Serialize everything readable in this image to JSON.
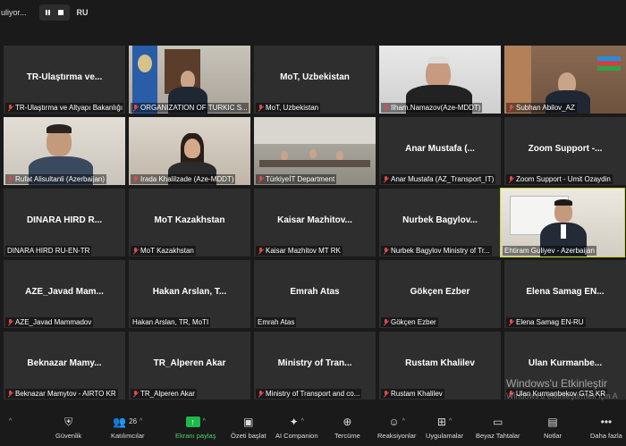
{
  "topbar": {
    "status": "uliyor...",
    "lang": "RU"
  },
  "tiles": [
    {
      "big": "TR-Ulaştırma ve...",
      "name": "TR-Ulaştırma ve Altyapı Bakanlığı"
    },
    {
      "big": "",
      "name": "ORGANIZATION OF TURKIC S..."
    },
    {
      "big": "MoT, Uzbekistan",
      "name": "MoT, Uzbekistan"
    },
    {
      "big": "",
      "name": "Ilham.Namazov(Aze-MDDT)"
    },
    {
      "big": "",
      "name": "Subhan Abilov_AZ"
    },
    {
      "big": "",
      "name": "Rufat Alisultanli (Azerbaijan)"
    },
    {
      "big": "",
      "name": "Irada Khalilzade (Aze-MDDT)"
    },
    {
      "big": "",
      "name": "TürkiyeİT Department"
    },
    {
      "big": "Anar Mustafa (...",
      "name": "Anar Mustafa (AZ_Transport_IT)"
    },
    {
      "big": "Zoom Support -...",
      "name": "Zoom Support - Umit Ozaydin"
    },
    {
      "big": "DINARA HIRD R...",
      "name": "DINARA HIRD RU-EN-TR"
    },
    {
      "big": "MoT Kazakhstan",
      "name": "MoT Kazakhstan"
    },
    {
      "big": "Kaisar Mazhitov...",
      "name": "Kaisar Mazhitov MT RK"
    },
    {
      "big": "Nurbek Bagylov...",
      "name": "Nurbek Bagylov Ministry of Tr..."
    },
    {
      "big": "",
      "name": "Ehtiram Guliyev - Azerbaijan"
    },
    {
      "big": "AZE_Javad Mam...",
      "name": "AZE_Javad Mammadov"
    },
    {
      "big": "Hakan Arslan, T...",
      "name": "Hakan Arslan, TR, MoTI"
    },
    {
      "big": "Emrah Atas",
      "name": "Emrah Atas"
    },
    {
      "big": "Gökçen Ezber",
      "name": "Gökçen Ezber"
    },
    {
      "big": "Elena Samag EN...",
      "name": "Elena Samag EN-RU"
    },
    {
      "big": "Beknazar Mamy...",
      "name": "Beknazar Mamytov - AIRTO KR"
    },
    {
      "big": "TR_Alperen Akar",
      "name": "TR_Alperen Akar"
    },
    {
      "big": "Ministry of Tran...",
      "name": "Ministry of Transport and co..."
    },
    {
      "big": "Rustam Khalilev",
      "name": "Rustam Khalilev"
    },
    {
      "big": "Ulan Kurmanbe...",
      "name": "Ulan Kurmanbekov GTS KR"
    }
  ],
  "watermark": {
    "line1": "Windows'u Etkinleştir",
    "line2": "Windows'u etkinleştirmek için A"
  },
  "toolbar": {
    "security": "Güvenlik",
    "participants": "Katılımcılar",
    "participants_count": "26",
    "share": "Ekranı paylaş",
    "summary": "Özeti başlat",
    "ai": "AI Companion",
    "translate": "Tercüme",
    "reactions": "Reaksiyonlar",
    "apps": "Uygulamalar",
    "whiteboards": "Beyaz Tahtalar",
    "notes": "Notlar",
    "more": "Daha fazla"
  },
  "colors": {
    "active_border": "#c8d830",
    "share_green": "#1fb84a",
    "tile_bg": "#2e2e2e"
  }
}
